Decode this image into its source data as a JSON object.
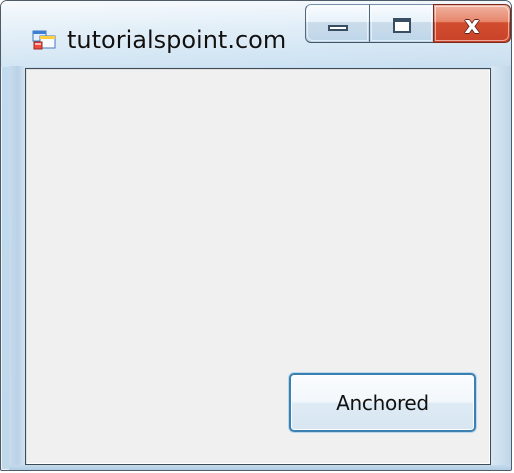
{
  "window": {
    "title": "tutorialspoint.com",
    "icon": "application-icon",
    "controls": {
      "minimize_icon": "minimize-icon",
      "maximize_icon": "maximize-icon",
      "close_icon": "close-icon",
      "close_label": "x"
    }
  },
  "client": {
    "button_label": "Anchored"
  },
  "colors": {
    "window_frame": "#bfd8ea",
    "client_background": "#f0f0f0",
    "close_button": "#d14d2f",
    "button_border": "#3c7fb1"
  }
}
